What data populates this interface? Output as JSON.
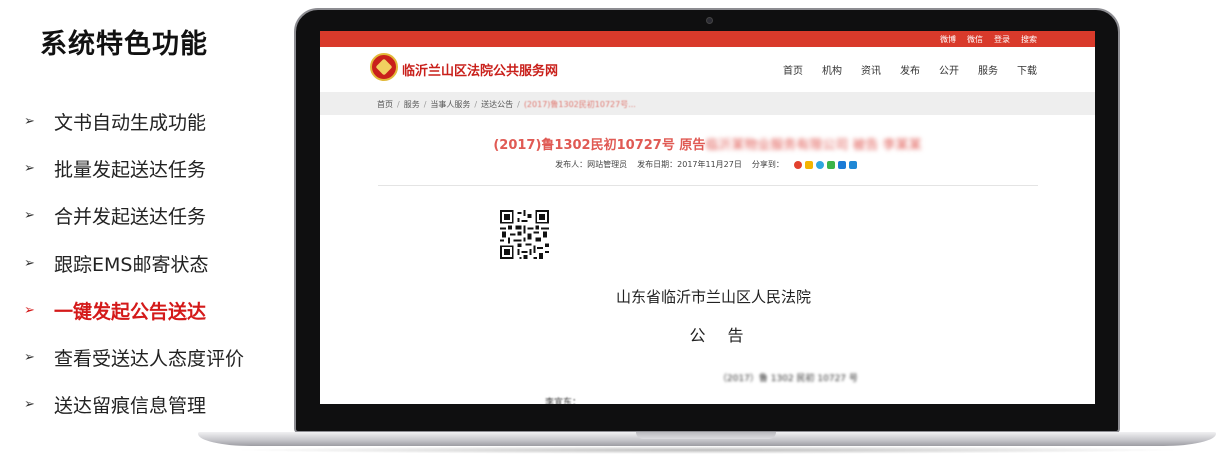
{
  "slide": {
    "title": "系统特色功能",
    "features": [
      {
        "label": "文书自动生成功能",
        "active": false
      },
      {
        "label": "批量发起送达任务",
        "active": false
      },
      {
        "label": "合并发起送达任务",
        "active": false
      },
      {
        "label": "跟踪EMS邮寄状态",
        "active": false
      },
      {
        "label": "一键发起公告送达",
        "active": true
      },
      {
        "label": "查看受送达人态度评价",
        "active": false
      },
      {
        "label": "送达留痕信息管理",
        "active": false
      }
    ],
    "bullet_symbol": "➢",
    "highlight_color": "#d41a1a"
  },
  "website": {
    "top_links": [
      "微博",
      "微信",
      "登录",
      "搜索"
    ],
    "site_name": "临沂兰山区法院公共服务网",
    "nav": [
      "首页",
      "机构",
      "资讯",
      "发布",
      "公开",
      "服务",
      "下载"
    ],
    "breadcrumb": [
      "首页",
      "服务",
      "当事人服务",
      "送达公告",
      "(2017)鲁1302民初10727号..."
    ],
    "notice_title_clear": "(2017)鲁1302民初10727号 原告",
    "notice_title_blurred": "临沂某物业服务有限公司 被告 李某某",
    "meta": {
      "publisher": "发布人：网站管理员",
      "date": "发布日期：2017年11月27日",
      "share": "分享到："
    },
    "share_icons": [
      "weibo-icon",
      "qzone-icon",
      "pengyou-icon",
      "wechat-icon",
      "tqq-icon",
      "more-share-icon"
    ],
    "court_name": "山东省临沂市兰山区人民法院",
    "announcement_heading": "公告",
    "case_number": "（2017）鲁 1302 民初 10727 号",
    "addressee": "李宜东：",
    "brand_color": "#d93a2b"
  }
}
